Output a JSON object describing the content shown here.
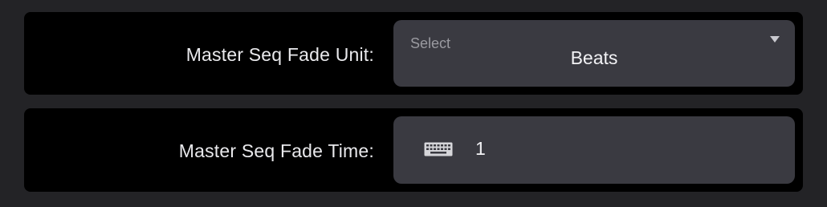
{
  "fade_unit": {
    "label": "Master Seq Fade Unit:",
    "caption": "Select",
    "value": "Beats",
    "dropdown_icon": "caret-down-icon"
  },
  "fade_time": {
    "label": "Master Seq Fade Time:",
    "value": "1",
    "input_icon": "keyboard-icon"
  },
  "colors": {
    "background": "#232326",
    "row": "#000000",
    "field": "#3a3a41",
    "text": "#e9e9ec",
    "caption": "#9a9aa0"
  }
}
